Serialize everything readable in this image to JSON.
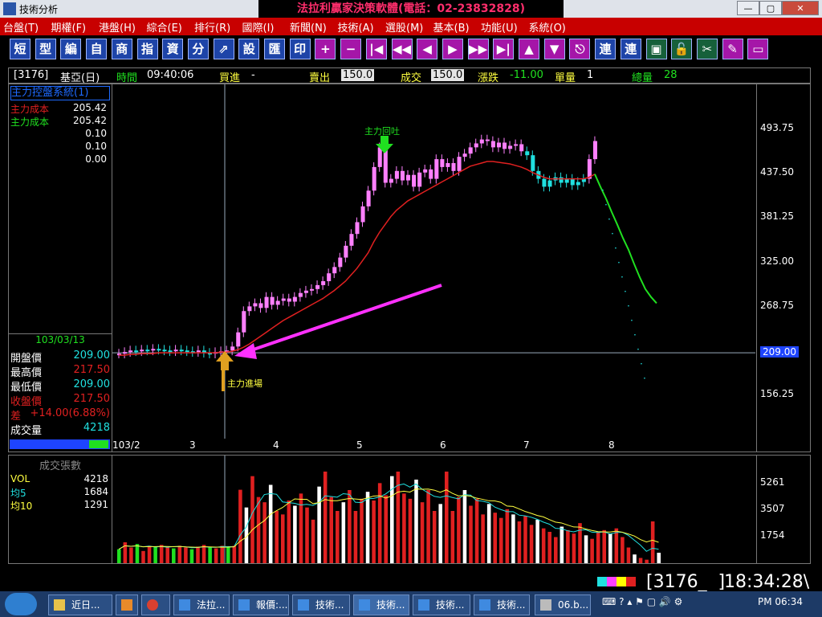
{
  "window": {
    "app_title": "技術分析",
    "center_title": "法拉利贏家決策軟體(電話：02-23832828)",
    "buttons": {
      "minimize": "—",
      "maximize": "▢",
      "close": "✕"
    }
  },
  "menu": [
    "台盤(T)",
    "期權(F)",
    "港盤(H)",
    "綜合(E)",
    "排行(R)",
    "國際(I)",
    "新聞(N)",
    "技術(A)",
    "選股(M)",
    "基本(B)",
    "功能(U)",
    "系統(O)"
  ],
  "toolbar": [
    {
      "label": "短",
      "icon": "short-icon"
    },
    {
      "label": "型",
      "icon": "pattern-icon"
    },
    {
      "label": "編",
      "icon": "edit-icon"
    },
    {
      "label": "自",
      "icon": "custom-icon"
    },
    {
      "label": "商",
      "icon": "product-icon"
    },
    {
      "label": "指",
      "icon": "index-icon"
    },
    {
      "label": "資",
      "icon": "data-icon"
    },
    {
      "label": "分",
      "icon": "minute-icon"
    },
    {
      "label": "⇗",
      "icon": "chart-icon"
    },
    {
      "label": "設",
      "icon": "settings-icon"
    },
    {
      "label": "匯",
      "icon": "export-icon"
    },
    {
      "label": "印",
      "icon": "print-icon"
    },
    {
      "label": "+",
      "icon": "zoom-in-icon"
    },
    {
      "label": "−",
      "icon": "zoom-out-icon"
    },
    {
      "label": "|◀",
      "icon": "first-icon"
    },
    {
      "label": "◀◀",
      "icon": "rewind-icon"
    },
    {
      "label": "◀",
      "icon": "prev-icon"
    },
    {
      "label": "▶",
      "icon": "next-icon"
    },
    {
      "label": "▶▶",
      "icon": "forward-icon"
    },
    {
      "label": "▶|",
      "icon": "last-icon"
    },
    {
      "label": "▲",
      "icon": "up-icon"
    },
    {
      "label": "▼",
      "icon": "down-icon"
    },
    {
      "label": "⎋",
      "icon": "esc-icon"
    },
    {
      "label": "連",
      "icon": "link-icon"
    },
    {
      "label": "連",
      "icon": "link2-icon"
    },
    {
      "label": "▣",
      "icon": "window-icon"
    },
    {
      "label": "🔓",
      "icon": "lock-icon"
    },
    {
      "label": "✂",
      "icon": "tools-icon"
    },
    {
      "label": "✎",
      "icon": "pen-icon"
    },
    {
      "label": "▭",
      "icon": "frame-icon"
    }
  ],
  "quote": {
    "code": "[3176]",
    "name": "基亞(日)",
    "time_label": "時間",
    "time": "09:40:06",
    "bid_label": "買進",
    "bid": "-",
    "ask_label": "賣出",
    "ask": "150.0",
    "last_label": "成交",
    "last": "150.0",
    "change_label": "漲跌",
    "change": "-11.00",
    "qty_label": "單量",
    "qty": "1",
    "total_label": "總量",
    "total": "28"
  },
  "indicator": {
    "title": "主力控盤系統(1)",
    "rows": [
      {
        "label": "主力成本",
        "value": "205.42",
        "color": "#e02020"
      },
      {
        "label": "主力成本",
        "value": "205.42",
        "color": "#20e020"
      },
      {
        "label": "",
        "value": "0.10"
      },
      {
        "label": "",
        "value": "0.10"
      },
      {
        "label": "",
        "value": "0.00"
      }
    ]
  },
  "ohlc": {
    "date": "103/03/13",
    "rows": [
      {
        "label": "開盤價",
        "value": "209.00",
        "lcolor": "#fff",
        "vcolor": "#20e0e0"
      },
      {
        "label": "最高價",
        "value": "217.50",
        "lcolor": "#fff",
        "vcolor": "#e02020"
      },
      {
        "label": "最低價",
        "value": "209.00",
        "lcolor": "#fff",
        "vcolor": "#20e0e0"
      },
      {
        "label": "收盤價",
        "value": "217.50",
        "lcolor": "#e02020",
        "vcolor": "#e02020"
      },
      {
        "label": "差",
        "value": "+14.00(6.88%)",
        "lcolor": "#e02020",
        "vcolor": "#e02020"
      },
      {
        "label": "成交量",
        "value": "4218",
        "lcolor": "#fff",
        "vcolor": "#20e0e0"
      }
    ]
  },
  "annotations": {
    "top": "主力回吐",
    "bottom": "主力進場"
  },
  "chart_data": [
    {
      "type": "candlestick",
      "y_ticks": [
        "493.75",
        "437.50",
        "381.25",
        "325.00",
        "268.75",
        "209.00",
        "156.25"
      ],
      "current_price_label": "209.00",
      "x_ticks": [
        "103/2",
        "3",
        "4",
        "5",
        "6",
        "7",
        "8"
      ],
      "ylim": [
        100,
        550
      ],
      "close": [
        208,
        210,
        212,
        211,
        213,
        212,
        214,
        213,
        212,
        211,
        213,
        212,
        211,
        210,
        212,
        209,
        208,
        210,
        211,
        212,
        217,
        235,
        262,
        268,
        272,
        266,
        280,
        270,
        275,
        278,
        274,
        280,
        285,
        288,
        290,
        295,
        300,
        310,
        318,
        330,
        345,
        360,
        375,
        395,
        415,
        445,
        470,
        425,
        430,
        440,
        428,
        435,
        420,
        438,
        442,
        430,
        455,
        445,
        450,
        440,
        458,
        462,
        470,
        475,
        480,
        478,
        470,
        476,
        468,
        472,
        474,
        465,
        460,
        440,
        430,
        420,
        428,
        432,
        425,
        430,
        422,
        426,
        430,
        455,
        478
      ],
      "ma": [
        206,
        206,
        207,
        207,
        208,
        208,
        208,
        209,
        209,
        209,
        209,
        209,
        209,
        209,
        209,
        209,
        209,
        209,
        210,
        210,
        211,
        213,
        216,
        220,
        225,
        230,
        235,
        240,
        245,
        250,
        254,
        258,
        262,
        266,
        270,
        274,
        278,
        283,
        288,
        294,
        300,
        308,
        316,
        326,
        336,
        350,
        362,
        372,
        382,
        390,
        396,
        402,
        406,
        410,
        414,
        418,
        422,
        426,
        430,
        434,
        438,
        442,
        446,
        448,
        450,
        452,
        452,
        451,
        450,
        449,
        447,
        445,
        442,
        438,
        435,
        432,
        430,
        430,
        430,
        430,
        430,
        430,
        430,
        432,
        436
      ],
      "projection": [
        436,
        420,
        405,
        388,
        372,
        355,
        340,
        322,
        305,
        290,
        280,
        272
      ]
    },
    {
      "type": "bar",
      "title": "成交張數",
      "y_ticks": [
        "5261",
        "3507",
        "1754"
      ],
      "vol_label": "VOL",
      "vol": "4218",
      "ma5_label": "均5",
      "ma5": "1684",
      "ma10_label": "均10",
      "ma10": "1291",
      "values": [
        800,
        1200,
        900,
        1100,
        700,
        1000,
        950,
        1050,
        900,
        850,
        1000,
        900,
        800,
        950,
        1050,
        900,
        850,
        1000,
        950,
        1000,
        4218,
        3200,
        5000,
        3800,
        3500,
        4500,
        3000,
        2800,
        3600,
        3300,
        4000,
        3200,
        2500,
        4400,
        5261,
        3800,
        3000,
        3500,
        4200,
        3000,
        3700,
        4100,
        3600,
        4600,
        3900,
        5000,
        5261,
        4000,
        3700,
        4800,
        3500,
        4200,
        3000,
        3400,
        5261,
        3000,
        3800,
        4200,
        3300,
        3700,
        2800,
        3400,
        2900,
        2600,
        3100,
        2800,
        2400,
        2700,
        2200,
        2500,
        2000,
        1800,
        1500,
        2100,
        1900,
        1700,
        2300,
        1600,
        1400,
        1800,
        1900,
        1700,
        2000,
        1500,
        900,
        500,
        300,
        200,
        2400,
        600
      ]
    }
  ]
}
